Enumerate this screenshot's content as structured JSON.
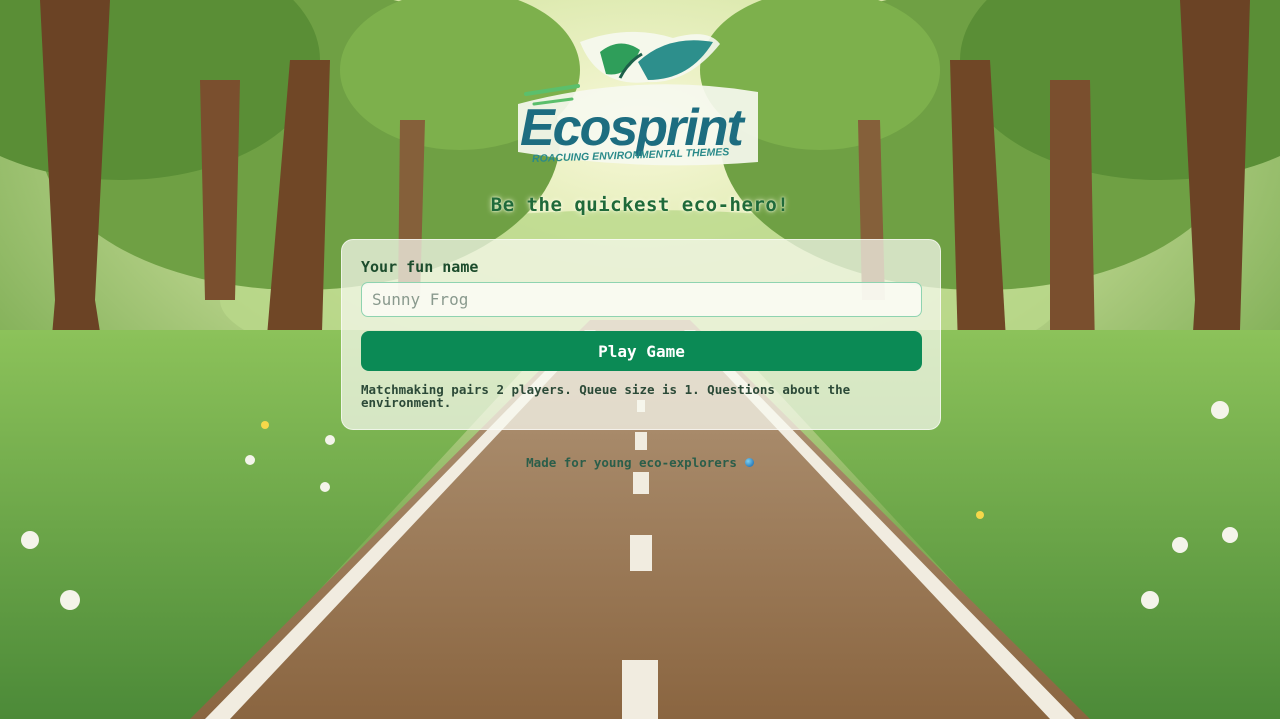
{
  "logo": {
    "word_part1": "Eco",
    "word_part2": "sprint",
    "tagline": "ROACUING ENVIRONMENTAL THEMES"
  },
  "headline": "Be the quickest eco-hero!",
  "form": {
    "name_label": "Your fun name",
    "name_placeholder": "Sunny Frog",
    "name_value": "",
    "play_label": "Play Game",
    "info": "Matchmaking pairs 2 players. Queue size is 1. Questions about the environment."
  },
  "footer": {
    "text": "Made for young eco-explorers",
    "icon": "globe-icon"
  },
  "colors": {
    "accent": "#0b8a55",
    "headline": "#1f6a3a",
    "logo_text": "#1d6d80"
  }
}
